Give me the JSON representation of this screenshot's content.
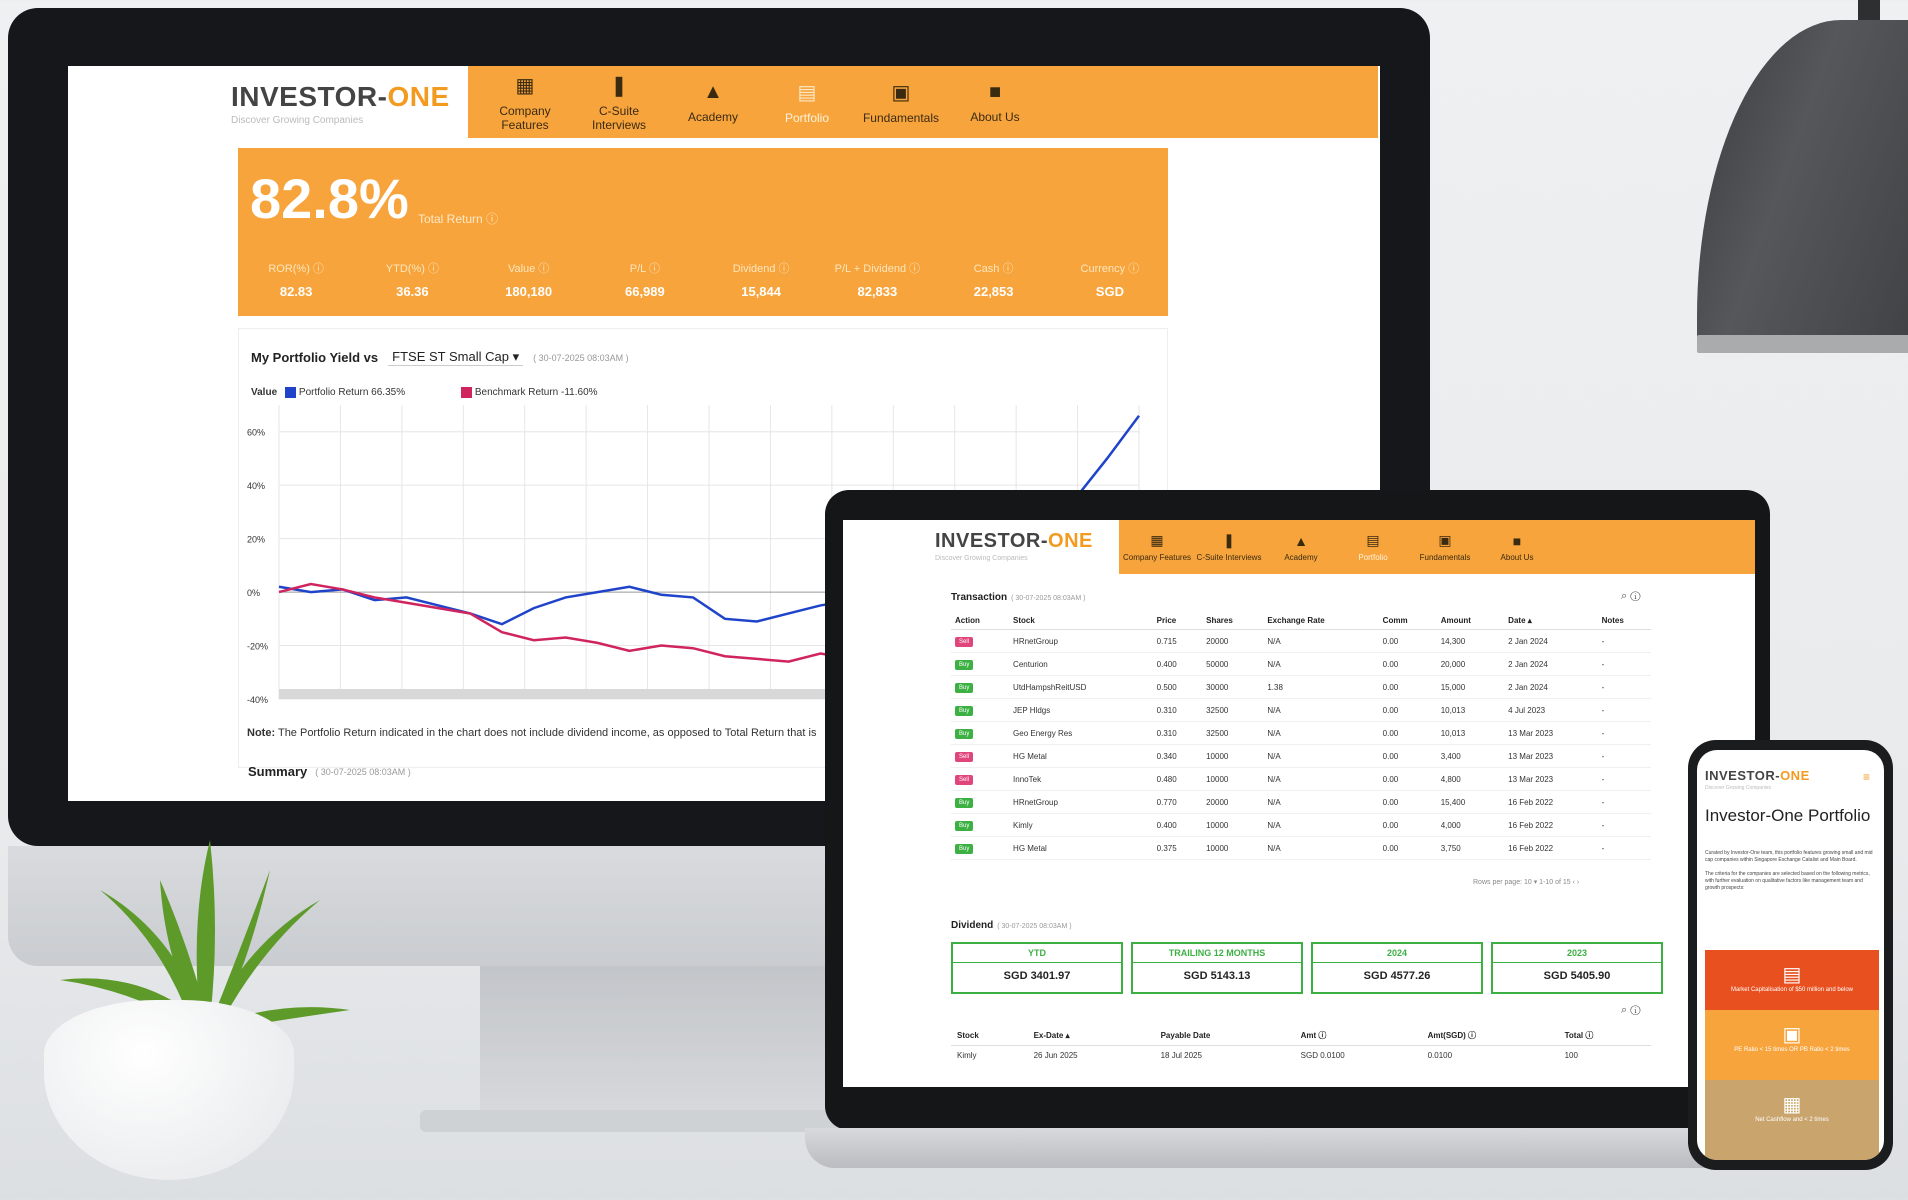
{
  "brand": {
    "name_main": "INVESTOR-",
    "name_accent": "ONE",
    "tagline": "Discover Growing Companies"
  },
  "colors": {
    "accent": "#f7a43c",
    "portfolio_line": "#1f44c9",
    "benchmark_line": "#d0245f",
    "buy": "#3cb043",
    "sell": "#e0457b"
  },
  "nav": [
    {
      "label": "Company Features",
      "icon": "building-icon",
      "glyph": "▦"
    },
    {
      "label": "C-Suite Interviews",
      "icon": "chat-bubbles-icon",
      "glyph": "❚"
    },
    {
      "label": "Academy",
      "icon": "graduation-cap-icon",
      "glyph": "▲"
    },
    {
      "label": "Portfolio",
      "icon": "document-icon",
      "glyph": "▤",
      "active": true
    },
    {
      "label": "Fundamentals",
      "icon": "presentation-icon",
      "glyph": "▣"
    },
    {
      "label": "About Us",
      "icon": "info-file-icon",
      "glyph": "■"
    }
  ],
  "desktop": {
    "total_return": "82.8%",
    "total_return_label": "Total Return ⓘ",
    "stats": [
      {
        "label": "ROR(%) ⓘ",
        "value": "82.83"
      },
      {
        "label": "YTD(%) ⓘ",
        "value": "36.36"
      },
      {
        "label": "Value ⓘ",
        "value": "180,180"
      },
      {
        "label": "P/L ⓘ",
        "value": "66,989"
      },
      {
        "label": "Dividend ⓘ",
        "value": "15,844"
      },
      {
        "label": "P/L + Dividend ⓘ",
        "value": "82,833"
      },
      {
        "label": "Cash ⓘ",
        "value": "22,853"
      },
      {
        "label": "Currency ⓘ",
        "value": "SGD"
      }
    ],
    "chart_title": "My Portfolio Yield vs",
    "benchmark_select": "FTSE ST Small Cap",
    "chart_timestamp": "( 30-07-2025 08:03AM )",
    "legend_prefix": "Value",
    "note_label": "Note:",
    "note_text": "The Portfolio Return indicated in the chart does not include dividend income, as opposed to Total Return that is",
    "summary_title": "Summary",
    "summary_timestamp": "( 30-07-2025 08:03AM )"
  },
  "chart_data": {
    "type": "line",
    "ylim": [
      -40,
      70
    ],
    "yticks": [
      "60%",
      "40%",
      "20%",
      "0%",
      "-20%",
      "-40%"
    ],
    "ytick_values": [
      60,
      40,
      20,
      0,
      -20,
      -40
    ],
    "series": [
      {
        "name": "Portfolio Return 66.35%",
        "color": "#1f44c9",
        "values": [
          2,
          0,
          1,
          -3,
          -2,
          -5,
          -8,
          -12,
          -6,
          -2,
          0,
          2,
          -1,
          -2,
          -10,
          -11,
          -8,
          -5,
          -3,
          -1,
          -2,
          0,
          5,
          10,
          20,
          35,
          50,
          66
        ]
      },
      {
        "name": "Benchmark Return -11.60%",
        "color": "#d0245f",
        "values": [
          0,
          3,
          1,
          -2,
          -4,
          -6,
          -8,
          -15,
          -18,
          -17,
          -19,
          -22,
          -20,
          -21,
          -24,
          -25,
          -26,
          -23,
          -25,
          -28,
          -27,
          -24,
          -25,
          -26,
          -27,
          -27,
          -27,
          -27
        ]
      }
    ]
  },
  "laptop": {
    "txn_title": "Transaction",
    "txn_timestamp": "( 30-07-2025 08:03AM )",
    "txn_headers": [
      "Action",
      "Stock",
      "Price",
      "Shares",
      "Exchange Rate",
      "Comm",
      "Amount",
      "Date ▴",
      "Notes"
    ],
    "txn_rows": [
      {
        "action": "Sell",
        "stock": "HRnetGroup",
        "price": "0.715",
        "shares": "20000",
        "fx": "N/A",
        "comm": "0.00",
        "amount": "14,300",
        "date": "2 Jan 2024",
        "notes": "-"
      },
      {
        "action": "Buy",
        "stock": "Centurion",
        "price": "0.400",
        "shares": "50000",
        "fx": "N/A",
        "comm": "0.00",
        "amount": "20,000",
        "date": "2 Jan 2024",
        "notes": "-"
      },
      {
        "action": "Buy",
        "stock": "UtdHampshReitUSD",
        "price": "0.500",
        "shares": "30000",
        "fx": "1.38",
        "comm": "0.00",
        "amount": "15,000",
        "date": "2 Jan 2024",
        "notes": "-"
      },
      {
        "action": "Buy",
        "stock": "JEP Hldgs",
        "price": "0.310",
        "shares": "32500",
        "fx": "N/A",
        "comm": "0.00",
        "amount": "10,013",
        "date": "4 Jul 2023",
        "notes": "-"
      },
      {
        "action": "Buy",
        "stock": "Geo Energy Res",
        "price": "0.310",
        "shares": "32500",
        "fx": "N/A",
        "comm": "0.00",
        "amount": "10,013",
        "date": "13 Mar 2023",
        "notes": "-"
      },
      {
        "action": "Sell",
        "stock": "HG Metal",
        "price": "0.340",
        "shares": "10000",
        "fx": "N/A",
        "comm": "0.00",
        "amount": "3,400",
        "date": "13 Mar 2023",
        "notes": "-"
      },
      {
        "action": "Sell",
        "stock": "InnoTek",
        "price": "0.480",
        "shares": "10000",
        "fx": "N/A",
        "comm": "0.00",
        "amount": "4,800",
        "date": "13 Mar 2023",
        "notes": "-"
      },
      {
        "action": "Buy",
        "stock": "HRnetGroup",
        "price": "0.770",
        "shares": "20000",
        "fx": "N/A",
        "comm": "0.00",
        "amount": "15,400",
        "date": "16 Feb 2022",
        "notes": "-"
      },
      {
        "action": "Buy",
        "stock": "Kimly",
        "price": "0.400",
        "shares": "10000",
        "fx": "N/A",
        "comm": "0.00",
        "amount": "4,000",
        "date": "16 Feb 2022",
        "notes": "-"
      },
      {
        "action": "Buy",
        "stock": "HG Metal",
        "price": "0.375",
        "shares": "10000",
        "fx": "N/A",
        "comm": "0.00",
        "amount": "3,750",
        "date": "16 Feb 2022",
        "notes": "-"
      }
    ],
    "pager": "Rows per page: 10 ▾   1-10 of 15   ‹  ›",
    "div_title": "Dividend",
    "div_timestamp": "( 30-07-2025 08:03AM )",
    "div_boxes": [
      {
        "h": "YTD",
        "v": "SGD 3401.97"
      },
      {
        "h": "TRAILING 12 MONTHS",
        "v": "SGD 5143.13"
      },
      {
        "h": "2024",
        "v": "SGD 4577.26"
      },
      {
        "h": "2023",
        "v": "SGD 5405.90"
      }
    ],
    "div_headers": [
      "Stock",
      "Ex-Date ▴",
      "Payable Date",
      "Amt ⓘ",
      "Amt(SGD) ⓘ",
      "Total ⓘ"
    ],
    "div_rows": [
      {
        "stock": "Kimly",
        "ex": "26 Jun 2025",
        "pay": "18 Jul 2025",
        "amt": "SGD 0.0100",
        "amt_sgd": "0.0100",
        "total": "100"
      }
    ]
  },
  "phone": {
    "title": "Investor-One Portfolio",
    "intro": "Curated by Investor-One team, this portfolio features growing small and mid cap companies within Singapore Exchange Catalist and Main Board.",
    "criteria": "The criteria for the companies are selected based on the following metrics, with further evaluation on qualitative factors like management team and growth prospects:",
    "block1": "Market Capitalisation of $50 million and below",
    "block2": "PE Ratio < 15 times OR PB Ratio < 2 times",
    "block3": "Net Cashflow and < 2 times"
  }
}
